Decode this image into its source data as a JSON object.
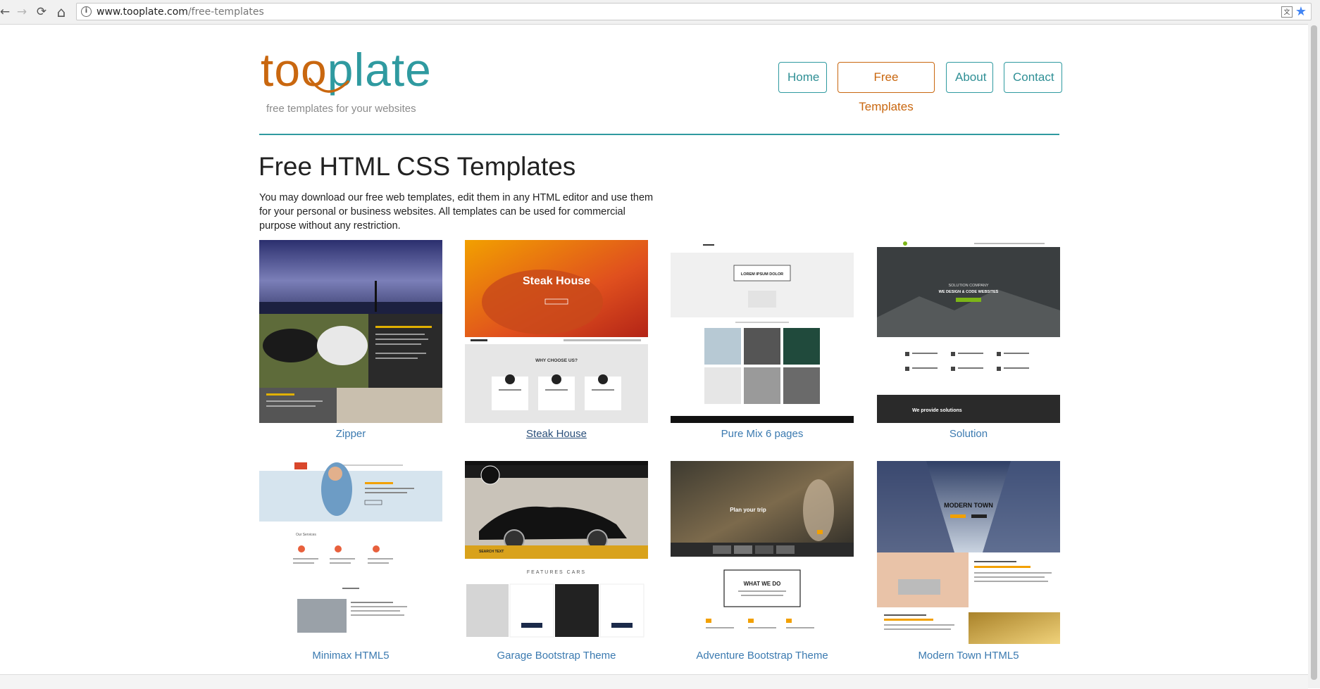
{
  "browser": {
    "url_host": "www.tooplate.com",
    "url_path": "/free-templates",
    "back_icon": "←",
    "forward_icon": "→",
    "reload_icon": "⟳",
    "home_icon": "⌂",
    "info_icon": "i",
    "translate_icon": "文",
    "star_icon": "★"
  },
  "logo": {
    "part1": "too",
    "part2": "plate",
    "tagline": "free templates for your websites"
  },
  "nav": [
    "Home",
    "Free Templates",
    "About",
    "Contact"
  ],
  "nav_active": "Free Templates",
  "page": {
    "title": "Free HTML CSS Templates",
    "intro": "You may download our free web templates, edit them in any HTML editor and use them for your personal or business websites. All templates can be used for commercial purpose without any restriction."
  },
  "templates": [
    {
      "name": "Zipper",
      "caption": "Zipper"
    },
    {
      "name": "Steak House",
      "caption": "Steak House",
      "heading": "WHY CHOOSE US?",
      "banner": "Steak House",
      "hovered": true
    },
    {
      "name": "Pure Mix 6 pages",
      "caption": "LOREM IPSUM DOLOR"
    },
    {
      "name": "Solution",
      "caption": "SOLUTION COMPANY",
      "heading": "WE DESIGN & CODE WEBSITES",
      "banner": "We provide solutions"
    },
    {
      "name": "Minimax HTML5",
      "caption": "Our Services"
    },
    {
      "name": "Garage Bootstrap Theme",
      "caption": "FEATURES CARS",
      "heading": "SEARCH TEXT"
    },
    {
      "name": "Adventure Bootstrap Theme",
      "caption": "Plan your trip",
      "heading": "WHAT WE DO"
    },
    {
      "name": "Modern Town HTML5",
      "caption": "MODERN TOWN"
    }
  ],
  "colors": {
    "teal": "#2f9aa0",
    "orange": "#c9670f",
    "link": "#3b7ab0"
  }
}
